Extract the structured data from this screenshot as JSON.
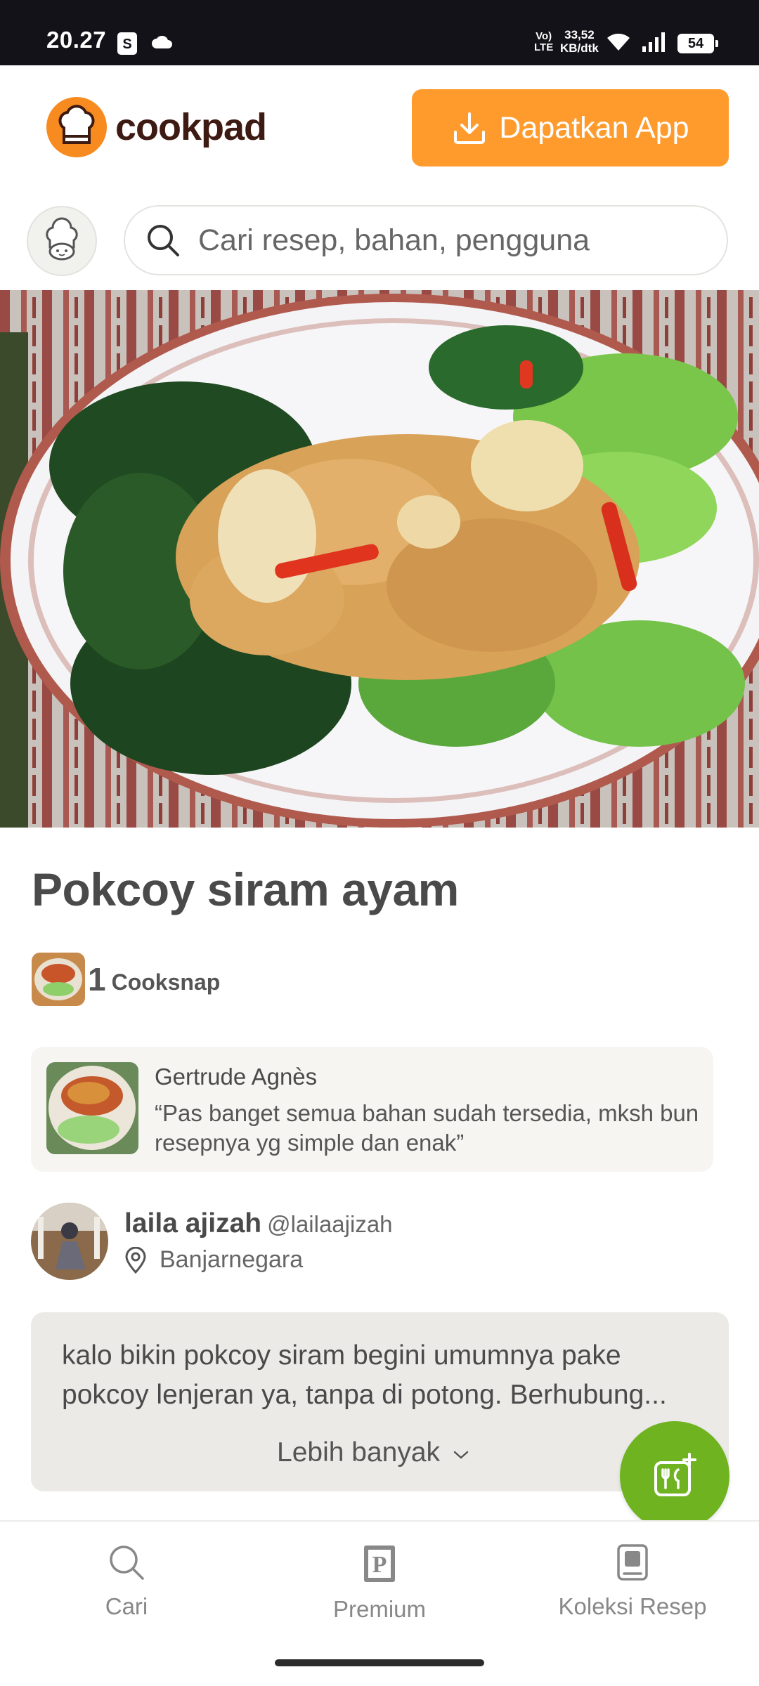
{
  "status_bar": {
    "time": "20.27",
    "volte": "Vo)\nLTE",
    "speed": "33,52\nKB/dtk",
    "battery": "54"
  },
  "header": {
    "logo_text": "cookpad",
    "get_app_label": "Dapatkan App"
  },
  "search": {
    "placeholder": "Cari resep, bahan, pengguna"
  },
  "recipe": {
    "title": "Pokcoy siram ayam",
    "cooksnap_count": "1",
    "cooksnap_label": "Cooksnap"
  },
  "review": {
    "author": "Gertrude Agnès",
    "text": "“Pas banget semua bahan sudah tersedia, mksh bun resepnya yg simple dan enak”"
  },
  "author": {
    "name": "laila ajizah",
    "handle": "@lailaajizah",
    "location": "Banjarnegara"
  },
  "description": {
    "text": "kalo bikin pokcoy siram begini umumnya pake pokcoy lenjeran ya, tanpa di potong. Berhubung...",
    "more_label": "Lebih banyak"
  },
  "bottom_nav": {
    "search": "Cari",
    "premium": "Premium",
    "collection": "Koleksi Resep"
  },
  "colors": {
    "brand_orange": "#ff9b2d",
    "fab_green": "#6fb320",
    "logo_brown": "#3d1a12"
  },
  "icons": [
    "shopee-icon",
    "cloud-icon",
    "wifi-icon",
    "signal-icon",
    "battery-icon",
    "chef-hat-icon",
    "download-icon",
    "search-icon",
    "location-pin-icon",
    "chevron-down-icon",
    "add-recipe-icon",
    "premium-icon",
    "bookmark-icon"
  ]
}
